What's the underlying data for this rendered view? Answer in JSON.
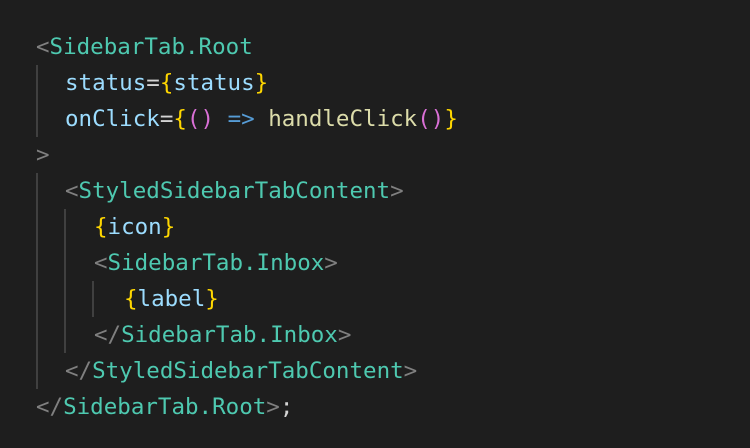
{
  "editor": {
    "background": "#1e1e1e",
    "colors": {
      "bracket": "#808080",
      "component": "#4ec9b0",
      "attribute": "#9cdcfe",
      "brace": "#ffd700",
      "paren": "#da70d6",
      "arrow": "#569cd6",
      "function": "#dcdcaa",
      "plain": "#d4d4d4",
      "indent_guide": "#404040"
    },
    "code": {
      "l1": {
        "lt": "<",
        "tag": "SidebarTab.Root"
      },
      "l2": {
        "attr": "status",
        "eq": "=",
        "open": "{",
        "value": "status",
        "close": "}"
      },
      "l3": {
        "attr": "onClick",
        "eq": "=",
        "open": "{",
        "popen": "(",
        "pclose": ")",
        "arrow": "=>",
        "fn": "handleClick",
        "fpopen": "(",
        "fpclose": ")",
        "close": "}"
      },
      "l4": {
        "gt": ">"
      },
      "l5": {
        "lt": "<",
        "tag": "StyledSidebarTabContent",
        "gt": ">"
      },
      "l6": {
        "open": "{",
        "value": "icon",
        "close": "}"
      },
      "l7": {
        "lt": "<",
        "tag": "SidebarTab.Inbox",
        "gt": ">"
      },
      "l8": {
        "open": "{",
        "value": "label",
        "close": "}"
      },
      "l9": {
        "lt": "</",
        "tag": "SidebarTab.Inbox",
        "gt": ">"
      },
      "l10": {
        "lt": "</",
        "tag": "StyledSidebarTabContent",
        "gt": ">"
      },
      "l11": {
        "lt": "</",
        "tag": "SidebarTab.Root",
        "gt": ">",
        "semi": ";"
      }
    }
  }
}
